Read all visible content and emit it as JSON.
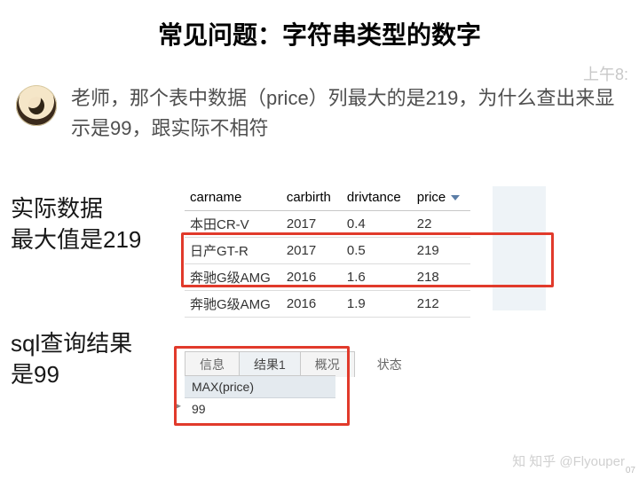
{
  "title": "常见问题：字符串类型的数字",
  "time": "上午8:",
  "question": "老师，那个表中数据（price）列最大的是219，为什么查出来显示是99，跟实际不相符",
  "label_actual_l1": "实际数据",
  "label_actual_l2": "最大值是219",
  "label_sql_l1": "sql查询结果",
  "label_sql_l2": "是99",
  "table": {
    "headers": [
      "carname",
      "carbirth",
      "drivtance",
      "price"
    ],
    "rows": [
      [
        "本田CR-V",
        "2017",
        "0.4",
        "22"
      ],
      [
        "日产GT-R",
        "2017",
        "0.5",
        "219"
      ],
      [
        "奔驰G级AMG",
        "2016",
        "1.6",
        "218"
      ],
      [
        "奔驰G级AMG",
        "2016",
        "1.9",
        "212"
      ]
    ]
  },
  "tabs": {
    "info": "信息",
    "result": "结果1",
    "summary": "概况",
    "status": "状态"
  },
  "result": {
    "header": "MAX(price)",
    "value": "99",
    "marker": "▸"
  },
  "watermark": "知乎 @Flyouper",
  "corner": "07"
}
